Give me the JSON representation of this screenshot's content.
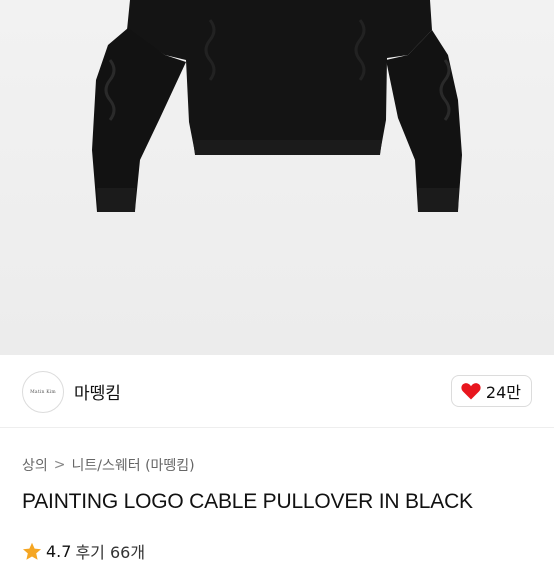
{
  "product": {
    "image_alt": "black cable knit pullover"
  },
  "seller": {
    "logo_text": "Matin Kim",
    "name": "마뗑킴"
  },
  "like": {
    "count": "24만",
    "color": "#e8161e"
  },
  "breadcrumb": {
    "level1": "상의",
    "separator": ">",
    "level2": "니트/스웨터 (마뗑킴)"
  },
  "title": "PAINTING LOGO CABLE PULLOVER IN BLACK",
  "rating": {
    "star_color": "#f5a623",
    "score": "4.7",
    "reviews": "후기 66개"
  }
}
